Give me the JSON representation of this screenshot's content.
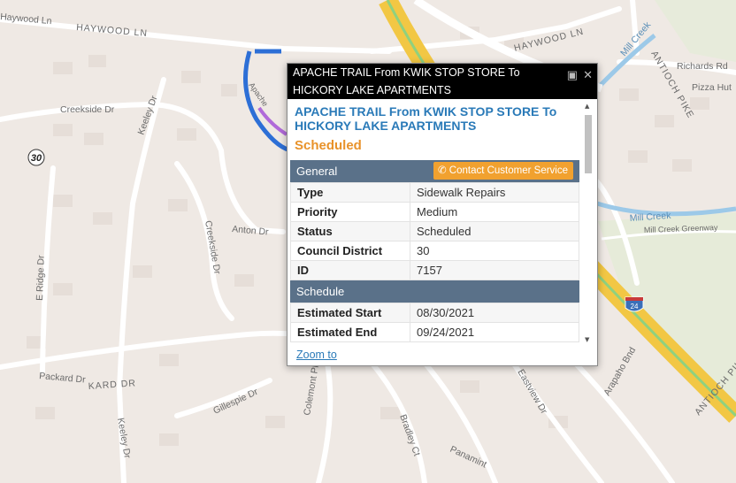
{
  "map": {
    "roads": [
      {
        "label": "Haywood Ln"
      },
      {
        "label": "HAYWOOD LN"
      },
      {
        "label": "HAYWOOD LN"
      },
      {
        "label": "Creekside Dr"
      },
      {
        "label": "Keeley Dr"
      },
      {
        "label": "E Ridge Dr"
      },
      {
        "label": "Creekside Dr"
      },
      {
        "label": "Anton Dr"
      },
      {
        "label": "Packard Dr"
      },
      {
        "label": "KARD DR"
      },
      {
        "label": "Gillespie Dr"
      },
      {
        "label": "Colemont Pl"
      },
      {
        "label": "Keeley Dr"
      },
      {
        "label": "Bradley Ct"
      },
      {
        "label": "Panamint"
      },
      {
        "label": "Eastview Dr"
      },
      {
        "label": "Arapaho Bnd"
      },
      {
        "label": "Mill Creek"
      },
      {
        "label": "Richards Rd"
      },
      {
        "label": "Pizza Hut"
      },
      {
        "label": "ANTIOCH PIKE"
      },
      {
        "label": "Mill Creek"
      },
      {
        "label": "Mill Creek Greenway"
      },
      {
        "label": "Apache"
      },
      {
        "label": "ANTIOCH PIKE"
      }
    ],
    "route_badge": "30",
    "interstate_badge": "24"
  },
  "popup": {
    "window_title": "APACHE TRAIL From KWIK STOP STORE To HICKORY LAKE APARTMENTS",
    "heading": "APACHE TRAIL From KWIK STOP STORE To HICKORY LAKE APARTMENTS",
    "status": "Scheduled",
    "general_label": "General",
    "contact_button": "Contact Customer Service",
    "general_rows": [
      {
        "key": "Type",
        "value": "Sidewalk Repairs"
      },
      {
        "key": "Priority",
        "value": "Medium"
      },
      {
        "key": "Status",
        "value": "Scheduled"
      },
      {
        "key": "Council District",
        "value": "30"
      },
      {
        "key": "ID",
        "value": "7157"
      }
    ],
    "schedule_label": "Schedule",
    "schedule_rows": [
      {
        "key": "Estimated Start",
        "value": "08/30/2021"
      },
      {
        "key": "Estimated End",
        "value": "09/24/2021"
      }
    ],
    "zoom_link": "Zoom to"
  },
  "colors": {
    "title_blue": "#2a7ab8",
    "status_orange": "#e8922a",
    "section_header": "#5a7189",
    "contact_button": "#f1a12f",
    "work_route": "#2d6fd6",
    "highway": "#f2c744",
    "creek": "#9cc9e8"
  }
}
